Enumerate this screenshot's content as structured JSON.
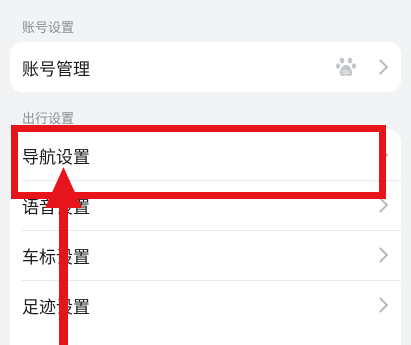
{
  "sections": {
    "account": {
      "title": "账号设置",
      "items": [
        {
          "label": "账号管理",
          "icon": "baidu-paw-icon"
        }
      ]
    },
    "travel": {
      "title": "出行设置",
      "items": [
        {
          "label": "导航设置"
        },
        {
          "label": "语音设置"
        },
        {
          "label": "车标设置"
        },
        {
          "label": "足迹设置"
        }
      ]
    }
  },
  "annotation": {
    "color": "#e8141b",
    "highlight_target": "导航设置"
  }
}
